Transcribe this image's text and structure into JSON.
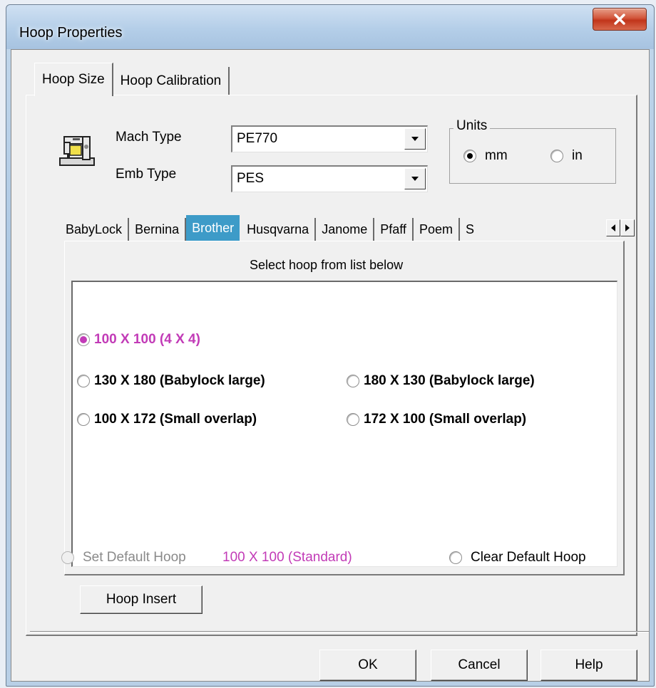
{
  "window": {
    "title": "Hoop Properties",
    "close_glyph": "X"
  },
  "main_tabs": [
    {
      "label": "Hoop Size",
      "active": true
    },
    {
      "label": "Hoop Calibration",
      "active": false
    }
  ],
  "machine": {
    "icon": "sewing-machine-icon",
    "mach_type_label": "Mach Type",
    "mach_type_value": "PE770",
    "emb_type_label": "Emb Type",
    "emb_type_value": "PES"
  },
  "units": {
    "legend": "Units",
    "mm_label": "mm",
    "in_label": "in",
    "selected": "mm"
  },
  "brand_tabs": [
    {
      "label": "BabyLock",
      "active": false
    },
    {
      "label": "Bernina",
      "active": false
    },
    {
      "label": "Brother",
      "active": true
    },
    {
      "label": "Husqvarna",
      "active": false
    },
    {
      "label": "Janome",
      "active": false
    },
    {
      "label": "Pfaff",
      "active": false
    },
    {
      "label": "Poem",
      "active": false
    },
    {
      "label": "S",
      "active": false
    }
  ],
  "hoop_list": {
    "heading": "Select hoop from list below",
    "items": [
      {
        "label": "100 X 100 (4 X 4)",
        "selected": true
      },
      {
        "label": "130 X 180 (Babylock large)",
        "selected": false
      },
      {
        "label": "180 X 130 (Babylock large)",
        "selected": false
      },
      {
        "label": "100 X 172 (Small overlap)",
        "selected": false
      },
      {
        "label": "172 X 100 (Small overlap)",
        "selected": false
      }
    ]
  },
  "default_hoop": {
    "set_label": "Set Default Hoop",
    "current_value": "100 X 100 (Standard)",
    "clear_label": "Clear Default Hoop"
  },
  "buttons": {
    "hoop_insert": "Hoop Insert",
    "ok": "OK",
    "cancel": "Cancel",
    "help": "Help"
  },
  "colors": {
    "accent_tab": "#3d9bc8",
    "selected_text": "#c23bb7",
    "close_button": "#c1351b"
  }
}
